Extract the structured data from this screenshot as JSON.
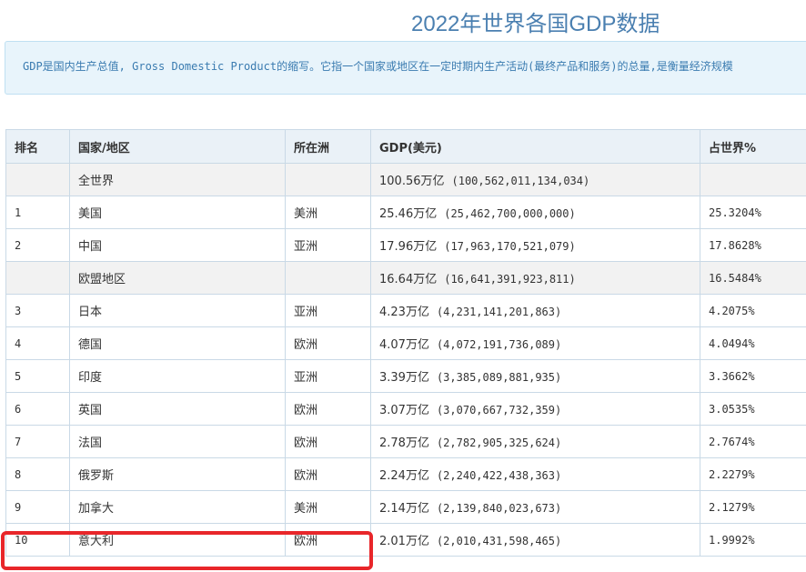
{
  "page": {
    "title": "2022年世界各国GDP数据",
    "notice": "GDP是国内生产总值, Gross Domestic Product的缩写。它指一个国家或地区在一定时期内生产活动(最终产品和服务)的总量,是衡量经济规模"
  },
  "table": {
    "headers": [
      "排名",
      "国家/地区",
      "所在洲",
      "GDP(美元)",
      "占世界%"
    ],
    "rows": [
      {
        "rank": "",
        "country": "全世界",
        "continent": "",
        "gdp": "100.56万亿",
        "gdp_full": "(100,562,011,134,034)",
        "share": "",
        "shaded": true
      },
      {
        "rank": "1",
        "country": "美国",
        "continent": "美洲",
        "gdp": "25.46万亿",
        "gdp_full": "(25,462,700,000,000)",
        "share": "25.3204%",
        "shaded": false
      },
      {
        "rank": "2",
        "country": "中国",
        "continent": "亚洲",
        "gdp": "17.96万亿",
        "gdp_full": "(17,963,170,521,079)",
        "share": "17.8628%",
        "shaded": false
      },
      {
        "rank": "",
        "country": "欧盟地区",
        "continent": "",
        "gdp": "16.64万亿",
        "gdp_full": "(16,641,391,923,811)",
        "share": "16.5484%",
        "shaded": true
      },
      {
        "rank": "3",
        "country": "日本",
        "continent": "亚洲",
        "gdp": "4.23万亿",
        "gdp_full": "(4,231,141,201,863)",
        "share": "4.2075%",
        "shaded": false
      },
      {
        "rank": "4",
        "country": "德国",
        "continent": "欧洲",
        "gdp": "4.07万亿",
        "gdp_full": "(4,072,191,736,089)",
        "share": "4.0494%",
        "shaded": false
      },
      {
        "rank": "5",
        "country": "印度",
        "continent": "亚洲",
        "gdp": "3.39万亿",
        "gdp_full": "(3,385,089,881,935)",
        "share": "3.3662%",
        "shaded": false
      },
      {
        "rank": "6",
        "country": "英国",
        "continent": "欧洲",
        "gdp": "3.07万亿",
        "gdp_full": "(3,070,667,732,359)",
        "share": "3.0535%",
        "shaded": false
      },
      {
        "rank": "7",
        "country": "法国",
        "continent": "欧洲",
        "gdp": "2.78万亿",
        "gdp_full": "(2,782,905,325,624)",
        "share": "2.7674%",
        "shaded": false
      },
      {
        "rank": "8",
        "country": "俄罗斯",
        "continent": "欧洲",
        "gdp": "2.24万亿",
        "gdp_full": "(2,240,422,438,363)",
        "share": "2.2279%",
        "shaded": false
      },
      {
        "rank": "9",
        "country": "加拿大",
        "continent": "美洲",
        "gdp": "2.14万亿",
        "gdp_full": "(2,139,840,023,673)",
        "share": "2.1279%",
        "shaded": false
      },
      {
        "rank": "10",
        "country": "意大利",
        "continent": "欧洲",
        "gdp": "2.01万亿",
        "gdp_full": "(2,010,431,598,465)",
        "share": "1.9992%",
        "shaded": false
      }
    ]
  },
  "colors": {
    "title": "#4a7fb0",
    "notice_bg": "#e8f4fb",
    "header_bg": "#eaf1f7",
    "shaded_row": "#f2f2f2",
    "highlight": "#e8262a"
  }
}
